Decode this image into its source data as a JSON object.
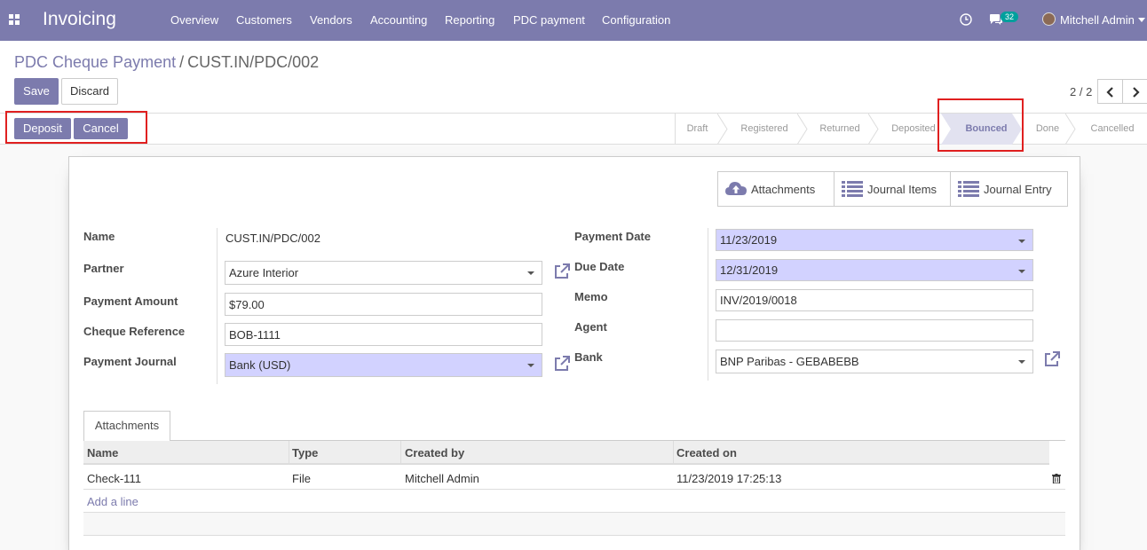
{
  "navbar": {
    "app_title": "Invoicing",
    "menu": [
      "Overview",
      "Customers",
      "Vendors",
      "Accounting",
      "Reporting",
      "PDC payment",
      "Configuration"
    ],
    "message_count": "32",
    "user_name": "Mitchell Admin"
  },
  "breadcrumb": {
    "parent": "PDC Cheque Payment",
    "separator": "/",
    "current": "CUST.IN/PDC/002"
  },
  "toolbar": {
    "save_label": "Save",
    "discard_label": "Discard",
    "pager": "2 / 2"
  },
  "header_buttons": {
    "deposit_label": "Deposit",
    "cancel_label": "Cancel"
  },
  "statusbar": {
    "steps": [
      "Draft",
      "Registered",
      "Returned",
      "Deposited",
      "Bounced",
      "Done",
      "Cancelled"
    ],
    "active": "Bounced"
  },
  "smart_buttons": {
    "attachments": "Attachments",
    "journal_items": "Journal Items",
    "journal_entry": "Journal Entry"
  },
  "form": {
    "name_label": "Name",
    "name_value": "CUST.IN/PDC/002",
    "partner_label": "Partner",
    "partner_value": "Azure Interior",
    "amount_label": "Payment Amount",
    "amount_value": "$79.00",
    "cheque_ref_label": "Cheque Reference",
    "cheque_ref_value": "BOB-1111",
    "journal_label": "Payment Journal",
    "journal_value": "Bank (USD)",
    "payment_date_label": "Payment Date",
    "payment_date_value": "11/23/2019",
    "due_date_label": "Due Date",
    "due_date_value": "12/31/2019",
    "memo_label": "Memo",
    "memo_value": "INV/2019/0018",
    "agent_label": "Agent",
    "agent_value": "",
    "bank_label": "Bank",
    "bank_value": "BNP Paribas - GEBABEBB"
  },
  "notebook": {
    "tab_label": "Attachments",
    "columns": [
      "Name",
      "Type",
      "Created by",
      "Created on"
    ],
    "rows": [
      {
        "name": "Check-111",
        "type": "File",
        "created_by": "Mitchell Admin",
        "created_on": "11/23/2019 17:25:13"
      }
    ],
    "add_line": "Add a line"
  },
  "colors": {
    "brand": "#7c7bad",
    "required_field": "#d2d2ff",
    "badge": "#00a09d",
    "highlight": "#e02020"
  }
}
